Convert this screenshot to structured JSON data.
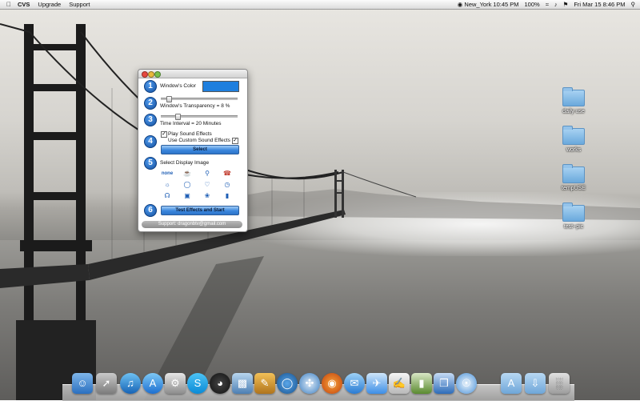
{
  "menubar": {
    "app_name": "CVS",
    "items": [
      "Upgrade",
      "Support"
    ],
    "clock_city": "New_York 10:45 PM",
    "battery": "100%",
    "date_time": "Fri Mar 15  8:46 PM"
  },
  "app_window": {
    "steps": [
      "1",
      "2",
      "3",
      "4",
      "5",
      "6"
    ],
    "color_label": "Window's Color",
    "window_color": "#1f7fde",
    "transparency_label": "Window's Transparency = 8 %",
    "transparency_percent": 8,
    "interval_label": "Time Interval = 20 Minutes",
    "interval_slider_fraction": 0.2,
    "play_sound_label": "Play Sound Effects",
    "play_sound_checked": true,
    "custom_sound_label": "Use Custom Sound Effects",
    "custom_sound_checked": true,
    "select_button": "Select",
    "display_image_label": "Select Display Image",
    "none_option": "none",
    "image_icons": [
      "teacup-icon",
      "cart-icon",
      "phone-icon",
      "lightbulb-icon",
      "bicycle-icon",
      "bottle-icon",
      "clock-icon",
      "headphones-icon",
      "camera-icon",
      "butterfly-icon",
      "mug-icon"
    ],
    "start_button": "Test Effects and Start",
    "support_text": "Support:   dragonbtv@gmail.com"
  },
  "desktop_folders": [
    "daily use",
    "works",
    "tempUSE",
    "test~pic"
  ]
}
